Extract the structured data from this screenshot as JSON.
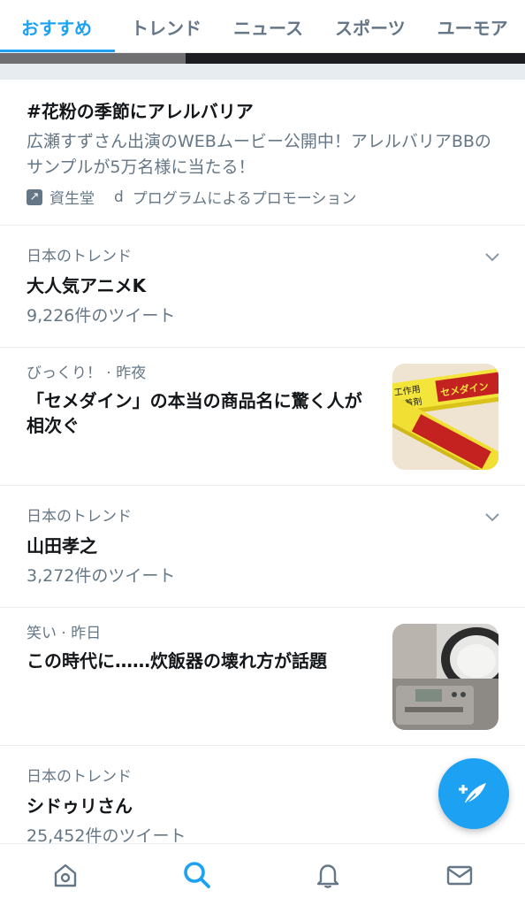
{
  "tabs": [
    {
      "label": "おすすめ",
      "active": true
    },
    {
      "label": "トレンド",
      "active": false
    },
    {
      "label": "ニュース",
      "active": false
    },
    {
      "label": "スポーツ",
      "active": false
    },
    {
      "label": "ユーモア",
      "active": false
    }
  ],
  "promoted": {
    "title": "#花粉の季節にアレルバリア",
    "body": "広瀬すずさん出演のWEBムービー公開中！アレルバリアBBのサンプルが5万名様に当たる！",
    "advertiser": "資生堂",
    "d_mark": "d",
    "label": "プログラムによるプロモーション",
    "icon": "promoted-arrow-icon"
  },
  "trends": [
    {
      "meta": "日本のトレンド",
      "name": "大人気アニメK",
      "count": "9,226件のツイート"
    },
    {
      "meta": "日本のトレンド",
      "name": "山田孝之",
      "count": "3,272件のツイート"
    },
    {
      "meta": "日本のトレンド",
      "name": "シドゥリさん",
      "count": "25,452件のツイート"
    }
  ],
  "news": [
    {
      "meta": "びっくり！ · 昨夜",
      "title": "「セメダイン」の本当の商品名に驚く人が相次ぐ",
      "thumb_text": [
        "工作用",
        "接着剤",
        "セメダイン"
      ]
    },
    {
      "meta": "笑い · 昨日",
      "title": "この時代に……炊飯器の壊れ方が話題"
    }
  ],
  "bottom_nav": [
    "home-icon",
    "search-icon",
    "notifications-icon",
    "messages-icon"
  ],
  "compose": {
    "icon": "compose-tweet-icon"
  },
  "colors": {
    "accent": "#1da1f2",
    "secondary_text": "#657786",
    "divider": "#e6ecf0"
  }
}
